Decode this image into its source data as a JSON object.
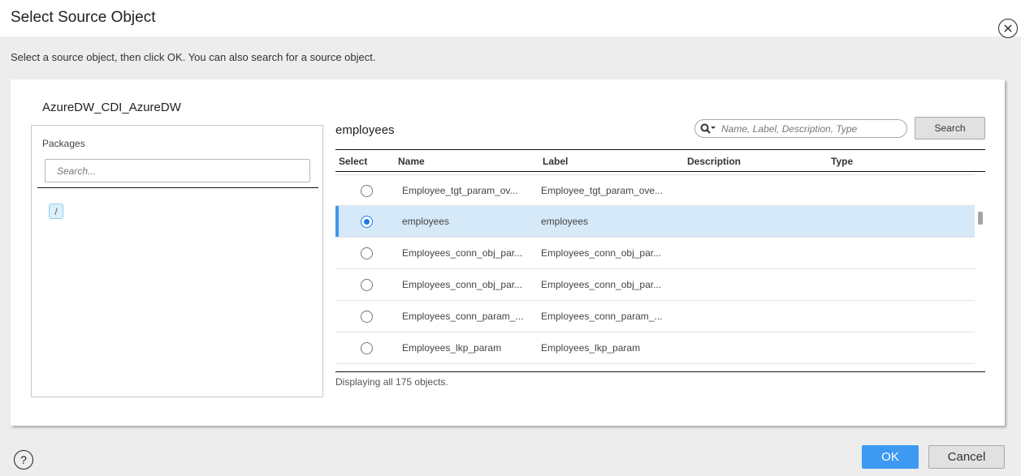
{
  "dialog": {
    "title": "Select Source Object",
    "instructions": "Select a source object, then click OK. You can also search for a source object.",
    "connection_name": "AzureDW_CDI_AzureDW"
  },
  "packages": {
    "label": "Packages",
    "search_placeholder": "Search...",
    "root_item": "/"
  },
  "objects": {
    "title": "employees",
    "search_placeholder": "Name, Label, Description, Type",
    "search_button": "Search",
    "columns": [
      "Select",
      "Name",
      "Label",
      "Description",
      "Type"
    ],
    "rows": [
      {
        "name": "Employee_tgt_param_ov...",
        "label": "Employee_tgt_param_ove...",
        "description": "",
        "type": "",
        "selected": false
      },
      {
        "name": "employees",
        "label": "employees",
        "description": "",
        "type": "",
        "selected": true
      },
      {
        "name": "Employees_conn_obj_par...",
        "label": "Employees_conn_obj_par...",
        "description": "",
        "type": "",
        "selected": false
      },
      {
        "name": "Employees_conn_obj_par...",
        "label": "Employees_conn_obj_par...",
        "description": "",
        "type": "",
        "selected": false
      },
      {
        "name": "Employees_conn_param_...",
        "label": "Employees_conn_param_...",
        "description": "",
        "type": "",
        "selected": false
      },
      {
        "name": "Employees_lkp_param",
        "label": "Employees_lkp_param",
        "description": "",
        "type": "",
        "selected": false
      }
    ],
    "count_text": "Displaying all 175 objects."
  },
  "footer": {
    "help_icon": "?",
    "ok_label": "OK",
    "cancel_label": "Cancel"
  },
  "colors": {
    "accent": "#3d9af3",
    "selected_row": "#d5e9f9",
    "radio_checked": "#1c7ae8"
  }
}
